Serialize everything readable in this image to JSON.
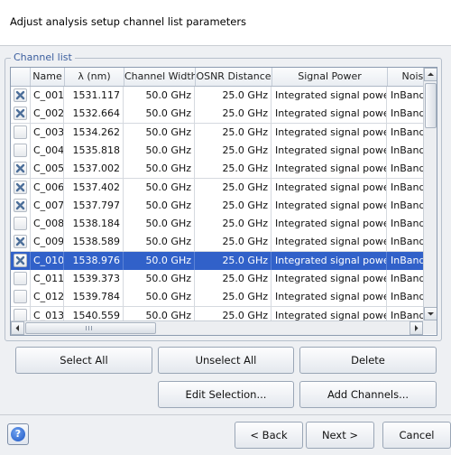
{
  "header": {
    "title": "Adjust analysis setup channel list parameters"
  },
  "channel_list": {
    "group_title": "Channel list",
    "columns": [
      "Name",
      "λ (nm)",
      "Channel Width",
      "OSNR Distance",
      "Signal Power",
      "Noise"
    ],
    "rows": [
      {
        "checked": true,
        "name": "C_001",
        "wavelength": "1531.117",
        "width": "50.0 GHz",
        "osnr": "25.0 GHz",
        "power": "Integrated signal power",
        "noise": "InBand"
      },
      {
        "checked": true,
        "name": "C_002",
        "wavelength": "1532.664",
        "width": "50.0 GHz",
        "osnr": "25.0 GHz",
        "power": "Integrated signal power",
        "noise": "InBand"
      },
      {
        "checked": false,
        "name": "C_003",
        "wavelength": "1534.262",
        "width": "50.0 GHz",
        "osnr": "25.0 GHz",
        "power": "Integrated signal power",
        "noise": "InBand"
      },
      {
        "checked": false,
        "name": "C_004",
        "wavelength": "1535.818",
        "width": "50.0 GHz",
        "osnr": "25.0 GHz",
        "power": "Integrated signal power",
        "noise": "InBand"
      },
      {
        "checked": true,
        "name": "C_005",
        "wavelength": "1537.002",
        "width": "50.0 GHz",
        "osnr": "25.0 GHz",
        "power": "Integrated signal power",
        "noise": "InBand"
      },
      {
        "checked": true,
        "name": "C_006",
        "wavelength": "1537.402",
        "width": "50.0 GHz",
        "osnr": "25.0 GHz",
        "power": "Integrated signal power",
        "noise": "InBand"
      },
      {
        "checked": true,
        "name": "C_007",
        "wavelength": "1537.797",
        "width": "50.0 GHz",
        "osnr": "25.0 GHz",
        "power": "Integrated signal power",
        "noise": "InBand"
      },
      {
        "checked": false,
        "name": "C_008",
        "wavelength": "1538.184",
        "width": "50.0 GHz",
        "osnr": "25.0 GHz",
        "power": "Integrated signal power",
        "noise": "InBand"
      },
      {
        "checked": true,
        "name": "C_009",
        "wavelength": "1538.589",
        "width": "50.0 GHz",
        "osnr": "25.0 GHz",
        "power": "Integrated signal power",
        "noise": "InBand"
      },
      {
        "checked": true,
        "name": "C_010",
        "wavelength": "1538.976",
        "width": "50.0 GHz",
        "osnr": "25.0 GHz",
        "power": "Integrated signal power",
        "noise": "InBand",
        "selected": true
      },
      {
        "checked": false,
        "name": "C_011",
        "wavelength": "1539.373",
        "width": "50.0 GHz",
        "osnr": "25.0 GHz",
        "power": "Integrated signal power",
        "noise": "InBand"
      },
      {
        "checked": false,
        "name": "C_012",
        "wavelength": "1539.784",
        "width": "50.0 GHz",
        "osnr": "25.0 GHz",
        "power": "Integrated signal power",
        "noise": "InBand"
      },
      {
        "checked": false,
        "name": "C_013",
        "wavelength": "1540.559",
        "width": "50.0 GHz",
        "osnr": "25.0 GHz",
        "power": "Integrated signal power",
        "noise": "InBand"
      }
    ]
  },
  "buttons": {
    "select_all": "Select All",
    "unselect_all": "Unselect All",
    "delete": "Delete",
    "edit_selection": "Edit Selection...",
    "add_channels": "Add Channels..."
  },
  "footer": {
    "help_label": "?",
    "back": "< Back",
    "next": "Next >",
    "cancel": "Cancel"
  },
  "colors": {
    "selection": "#3161c9",
    "group_title": "#3b5e9e",
    "check_mark": "#4d6f9a"
  },
  "icons": {
    "check": "x-check-icon",
    "scroll_up": "arrow-up-icon",
    "scroll_down": "arrow-down-icon",
    "scroll_left": "arrow-left-icon",
    "scroll_right": "arrow-right-icon",
    "help": "help-icon"
  }
}
